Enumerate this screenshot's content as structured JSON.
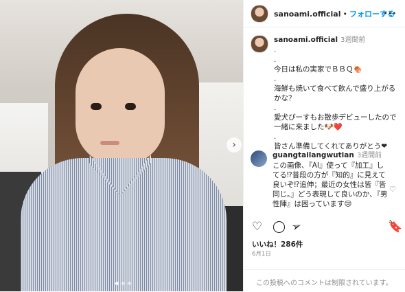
{
  "header": {
    "username": "sanoami.official",
    "separator": "•",
    "follow_label": "フォローする",
    "more_label": "···"
  },
  "caption": {
    "username": "sanoami.official",
    "time": "3週間前",
    "lines": [
      ".",
      ".",
      "今日は私の実家でＢＢＱ🍖",
      ".",
      "海鮮も焼いて食べて飲んで盛り上がるかな？",
      ".",
      "愛犬ぴーすもお散歩デビューしたので一緒に来ました🐶❤️",
      ".",
      "皆さん準備してくれてありがとう❤"
    ]
  },
  "comment": {
    "username": "guangtailangwutian",
    "time": "3週間前",
    "text": "この画像、『AI』使って『加工』してる⁉普段の方が『知的』に見えて良いぞ⁉追伸；最近の女性は皆『皆同じ。』どう表現して良いのか、『男性陣』は困っています😢"
  },
  "actions": {
    "like_icon": "heart-outline-icon",
    "comment_icon": "comment-bubble-icon",
    "share_icon": "paper-plane-icon",
    "save_icon": "bookmark-icon"
  },
  "likes": "いいね！286件",
  "date": "6月1日",
  "footer": {
    "message": "この投稿へのコメントは制限されています。"
  },
  "colors": {
    "accent": "#0095f6",
    "text": "#262626",
    "muted": "#8e8e8e",
    "border": "#efefef"
  }
}
